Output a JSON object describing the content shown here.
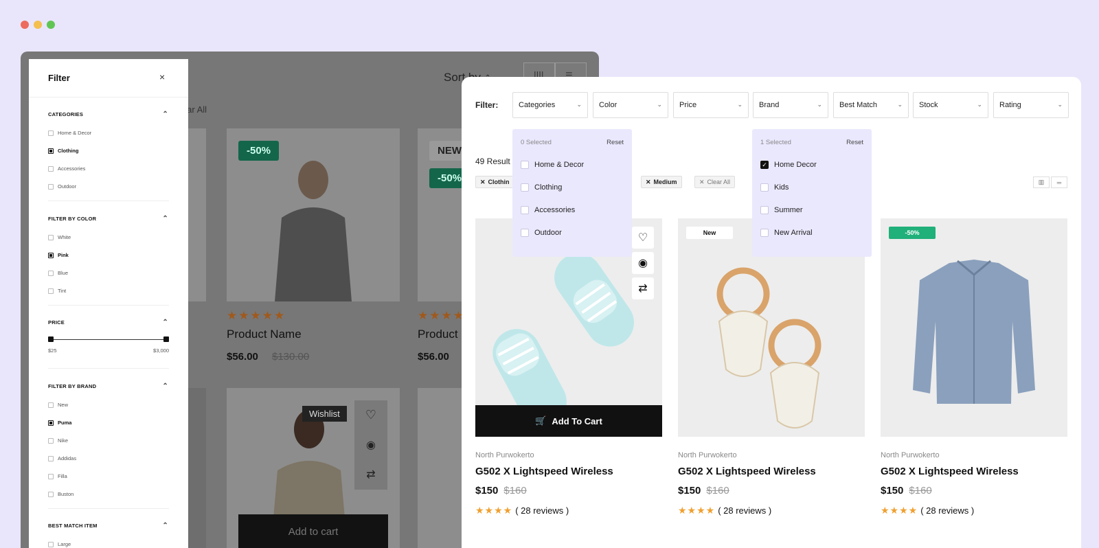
{
  "window_controls": {
    "colors": [
      "#ed6a5e",
      "#f4bf4f",
      "#61c554"
    ]
  },
  "back": {
    "sort_label": "Sort by",
    "clear_all": "lear All",
    "cards": [
      {
        "badge": "-50%",
        "name": "Product Name",
        "price": "$56.00",
        "old_price": "$130.00"
      },
      {
        "badge_top": "NEW",
        "badge": "-50%",
        "name": "Product",
        "price": "$56.00"
      }
    ],
    "wishlist": "Wishlist",
    "add_to_cart": "Add to cart",
    "stars": "★★★★★"
  },
  "sidebar": {
    "title": "Filter",
    "close": "×",
    "sections": [
      {
        "title": "CATEGORIES",
        "items": [
          {
            "label": "Home & Decor",
            "checked": false
          },
          {
            "label": "Clothing",
            "checked": true
          },
          {
            "label": "Accessories",
            "checked": false
          },
          {
            "label": "Outdoor",
            "checked": false
          }
        ]
      },
      {
        "title": "FILTER BY COLOR",
        "items": [
          {
            "label": "White",
            "checked": false
          },
          {
            "label": "Pink",
            "checked": true
          },
          {
            "label": "Blue",
            "checked": false
          },
          {
            "label": "Tint",
            "checked": false
          }
        ]
      },
      {
        "title": "PRICE",
        "min": "$25",
        "max": "$3,000"
      },
      {
        "title": "FILTER BY BRAND",
        "items": [
          {
            "label": "New",
            "checked": false
          },
          {
            "label": "Puma",
            "checked": true
          },
          {
            "label": "Nike",
            "checked": false
          },
          {
            "label": "Addidas",
            "checked": false
          },
          {
            "label": "Filla",
            "checked": false
          },
          {
            "label": "Buston",
            "checked": false
          }
        ]
      },
      {
        "title": "BEST MATCH ITEM",
        "items": [
          {
            "label": "Large",
            "checked": false
          }
        ]
      }
    ]
  },
  "front": {
    "filter_label": "Filter:",
    "selects": [
      "Categories",
      "Color",
      "Price",
      "Brand",
      "Best Match",
      "Stock",
      "Rating"
    ],
    "results": "49 Result",
    "chips": [
      "Clothin",
      "Medium",
      "Clear All"
    ],
    "dropdown_left": {
      "count": "0 Selected",
      "reset": "Reset",
      "items": [
        {
          "label": "Home & Decor",
          "checked": false
        },
        {
          "label": "Clothing",
          "checked": false
        },
        {
          "label": "Accessories",
          "checked": false
        },
        {
          "label": "Outdoor",
          "checked": false
        }
      ]
    },
    "dropdown_right": {
      "count": "1 Selected",
      "reset": "Reset",
      "items": [
        {
          "label": "Home Decor",
          "checked": true
        },
        {
          "label": "Kids",
          "checked": false
        },
        {
          "label": "Summer",
          "checked": false
        },
        {
          "label": "New Arrival",
          "checked": false
        }
      ]
    },
    "products": [
      {
        "tag": "",
        "location": "North Purwokerto",
        "name": "G502 X Lightspeed Wireless",
        "price": "$150",
        "old_price": "$160",
        "reviews": "( 28 reviews )",
        "cart": "Add To Cart"
      },
      {
        "tag": "New",
        "location": "North Purwokerto",
        "name": "G502 X Lightspeed Wireless",
        "price": "$150",
        "old_price": "$160",
        "reviews": "( 28 reviews )"
      },
      {
        "tag": "-50%",
        "location": "North Purwokerto",
        "name": "G502 X Lightspeed Wireless",
        "price": "$150",
        "old_price": "$160",
        "reviews": "( 28 reviews )"
      }
    ],
    "stars": "★★★★",
    "accent": "#20b07a"
  }
}
